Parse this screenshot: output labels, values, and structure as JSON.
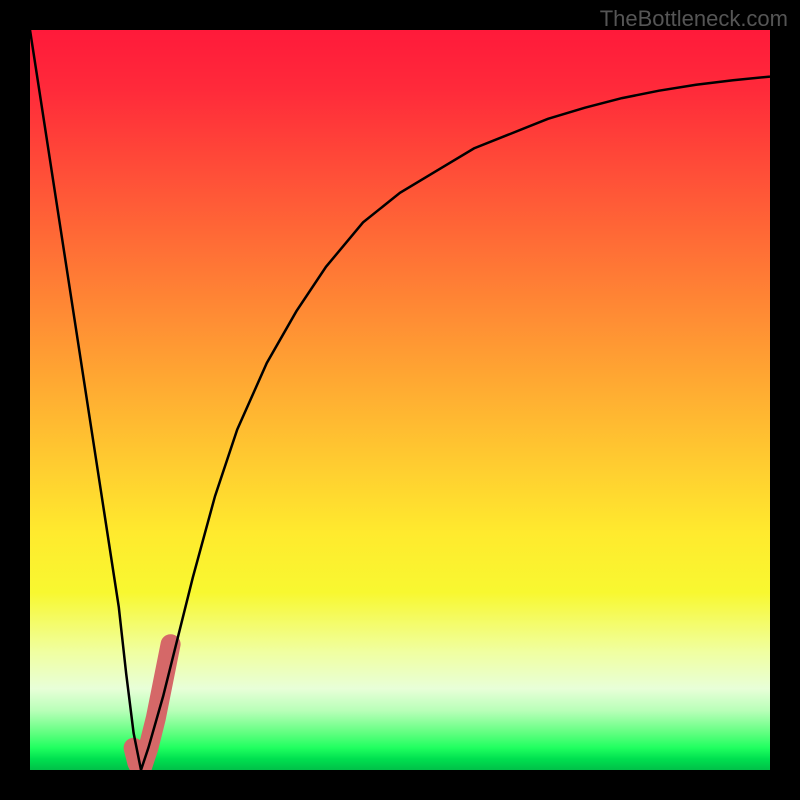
{
  "watermark": "TheBottleneck.com",
  "chart_data": {
    "type": "line",
    "title": "",
    "xlabel": "",
    "ylabel": "",
    "xlim": [
      0,
      100
    ],
    "ylim": [
      0,
      100
    ],
    "series": [
      {
        "name": "bottleneck-curve",
        "x": [
          0,
          2,
          4,
          6,
          8,
          10,
          12,
          13,
          14,
          15,
          16,
          18,
          20,
          22,
          25,
          28,
          32,
          36,
          40,
          45,
          50,
          55,
          60,
          65,
          70,
          75,
          80,
          85,
          90,
          95,
          100
        ],
        "values": [
          100,
          87,
          74,
          61,
          48,
          35,
          22,
          13,
          5,
          0,
          3,
          10,
          18,
          26,
          37,
          46,
          55,
          62,
          68,
          74,
          78,
          81,
          84,
          86,
          88,
          89.5,
          90.8,
          91.8,
          92.6,
          93.2,
          93.7
        ]
      }
    ],
    "marker": {
      "name": "highlight-segment",
      "x": [
        14,
        14.5,
        15,
        16,
        17,
        18,
        19
      ],
      "values": [
        3,
        1,
        0,
        3,
        7,
        12,
        17
      ],
      "color": "#d56868",
      "width": 20
    },
    "background": {
      "type": "gradient",
      "stops": [
        "#ff1a3a",
        "#ffea2e",
        "#00c048"
      ]
    }
  }
}
